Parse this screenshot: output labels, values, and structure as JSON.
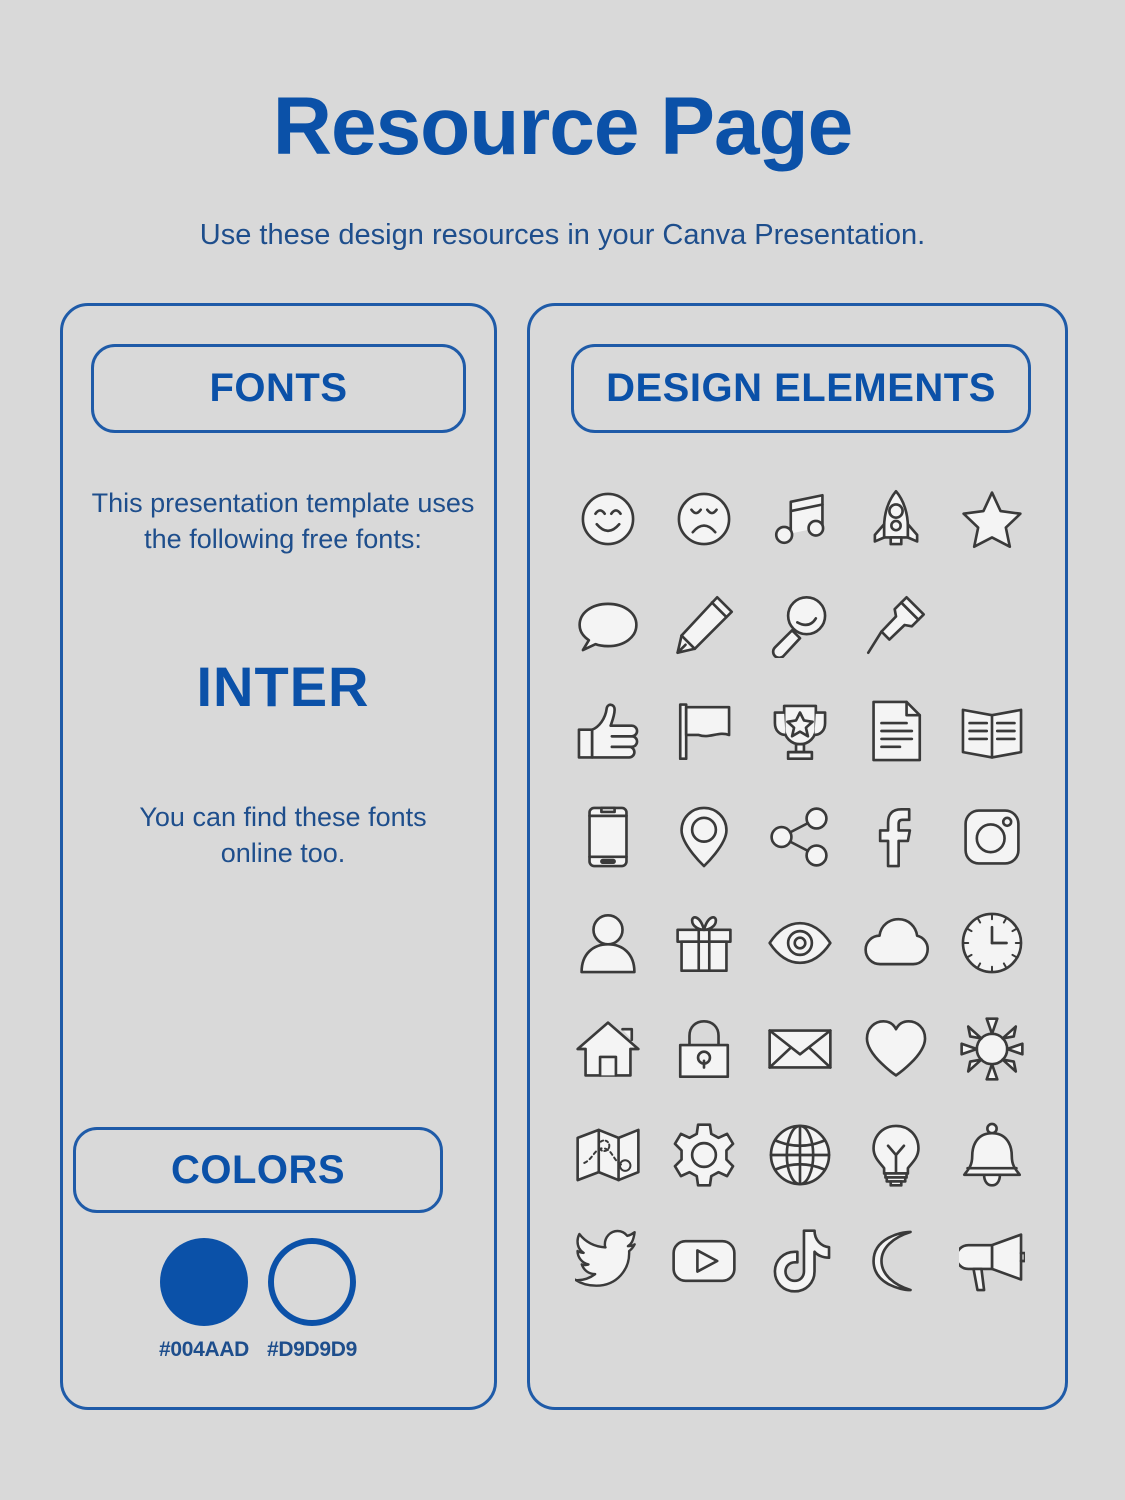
{
  "header": {
    "title": "Resource Page",
    "subtitle": "Use these design resources in your Canva Presentation."
  },
  "fonts_section": {
    "pill_label": "FONTS",
    "intro_text": "This presentation template uses the following free fonts:",
    "font_name": "INTER",
    "outro_text": "You can find these fonts online too."
  },
  "colors_section": {
    "pill_label": "COLORS",
    "swatches": [
      {
        "hex": "#004AAD",
        "label": "#004AAD",
        "style": "filled"
      },
      {
        "hex": "#D9D9D9",
        "label": "#D9D9D9",
        "style": "hollow"
      }
    ]
  },
  "design_section": {
    "pill_label": "DESIGN ELEMENTS",
    "rows": [
      [
        "smiley-face-icon",
        "sad-face-icon",
        "music-note-icon",
        "rocket-icon",
        "star-icon"
      ],
      [
        "speech-bubble-icon",
        "pencil-icon",
        "magnifying-glass-icon",
        "pushpin-icon"
      ],
      [
        "thumbs-up-icon",
        "flag-icon",
        "trophy-icon",
        "document-icon",
        "open-book-icon"
      ],
      [
        "smartphone-icon",
        "location-pin-icon",
        "share-icon",
        "facebook-icon",
        "instagram-icon"
      ],
      [
        "user-avatar-icon",
        "gift-icon",
        "eye-icon",
        "cloud-icon",
        "clock-icon"
      ],
      [
        "house-icon",
        "lock-icon",
        "envelope-icon",
        "heart-icon",
        "sun-icon"
      ],
      [
        "map-icon",
        "gear-icon",
        "globe-icon",
        "lightbulb-icon",
        "bell-icon"
      ],
      [
        "twitter-icon",
        "youtube-icon",
        "tiktok-icon",
        "moon-icon",
        "megaphone-icon"
      ]
    ]
  },
  "theme": {
    "background": "#D9D9D9",
    "accent_blue": "#004AAD",
    "text_blue": "#1E4E8C",
    "icon_stroke": "#3A3A3A"
  }
}
